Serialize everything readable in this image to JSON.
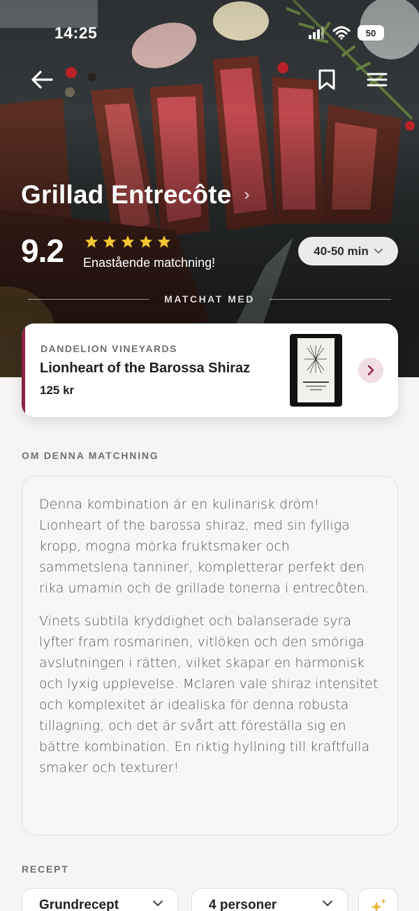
{
  "status_bar": {
    "time": "14:25",
    "battery": "50"
  },
  "nav": {
    "back_icon": "arrow-left-icon",
    "bookmark_icon": "bookmark-icon",
    "menu_icon": "hamburger-menu-icon"
  },
  "dish": {
    "title": "Grillad Entrecôte",
    "score": "9.2",
    "rating_stars": 5,
    "match_label": "Enastående matchning!",
    "time": "40-50 min"
  },
  "divider_label": "MATCHAT MED",
  "wine": {
    "winery": "DANDELION VINEYARDS",
    "name": "Lionheart of the Barossa Shiraz",
    "price": "125 kr",
    "accent_color": "#8e2244"
  },
  "about": {
    "heading": "OM DENNA MATCHNING",
    "paragraphs": [
      "Denna kombination är en kulinarisk dröm! Lionheart of the barossa shiraz, med sin fylliga kropp, mogna mörka fruktsmaker och sammetslena tanniner, kompletterar perfekt den rika umamin och de grillade tonerna i entrecôten.",
      "Vinets subtila kryddighet och balanserade syra lyfter fram rosmarinen, vitlöken och den smöriga avslutningen i rätten, vilket skapar en harmonisk och lyxig upplevelse. Mclaren vale shiraz intensitet och komplexitet är idealiska för denna robusta tillagning, och det är svårt att föreställa sig en bättre kombination. En riktig hyllning till kraftfulla smaker och texturer!"
    ]
  },
  "recipe": {
    "heading": "RECEPT",
    "variant": "Grundrecept",
    "servings": "4 personer",
    "ai_icon": "sparkle-icon"
  }
}
